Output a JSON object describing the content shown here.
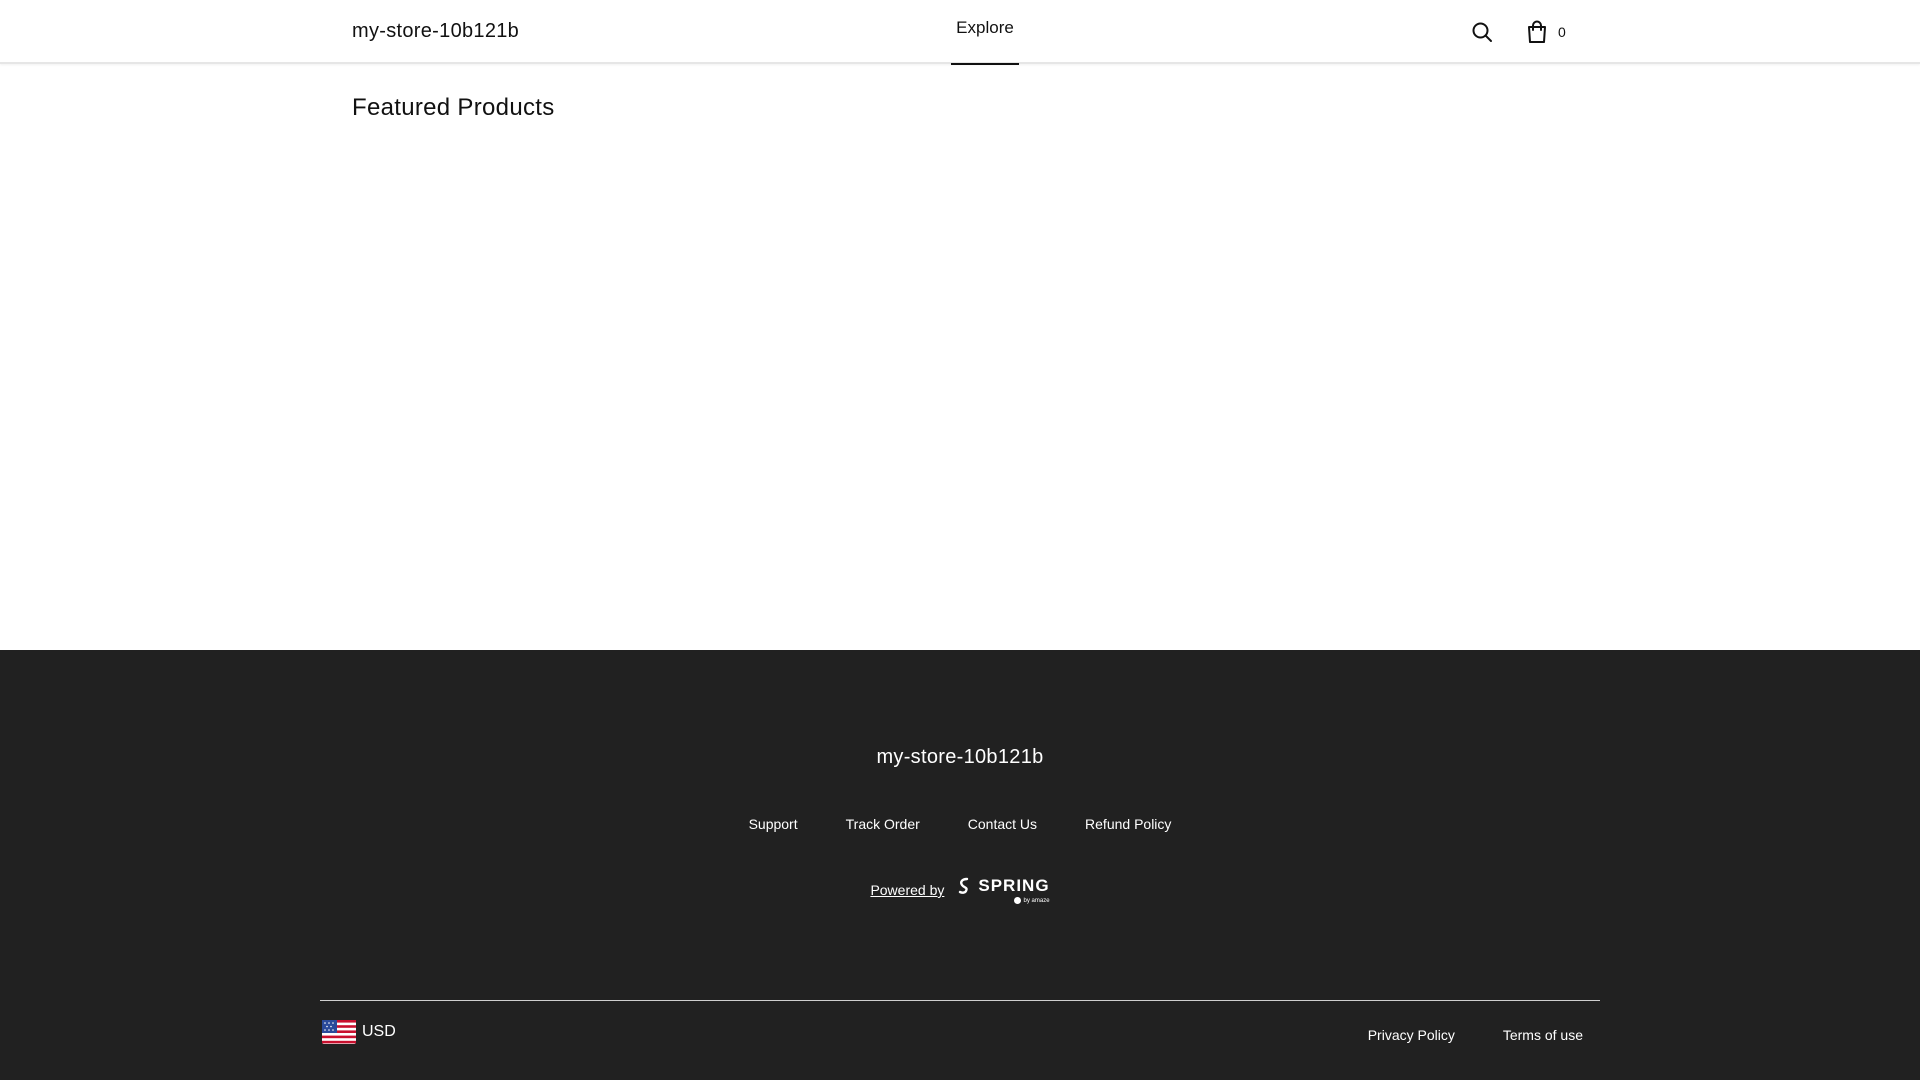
{
  "header": {
    "store_name": "my-store-10b121b",
    "nav": {
      "explore_label": "Explore"
    },
    "cart_count": "0",
    "icons": {
      "search": "search-icon",
      "cart": "shopping-bag-icon"
    }
  },
  "main": {
    "section_title": "Featured Products"
  },
  "footer": {
    "store_name": "my-store-10b121b",
    "links": [
      "Support",
      "Track Order",
      "Contact Us",
      "Refund Policy"
    ],
    "powered_by": "Powered by",
    "spring_logo": {
      "word": "SPRING",
      "sub": "by amaze"
    },
    "currency": {
      "label": "USD",
      "flag": "us-flag-icon"
    },
    "legal": {
      "privacy": "Privacy Policy",
      "terms": "Terms of use"
    },
    "colors": {
      "background": "#212121",
      "text": "#ffffff"
    }
  }
}
